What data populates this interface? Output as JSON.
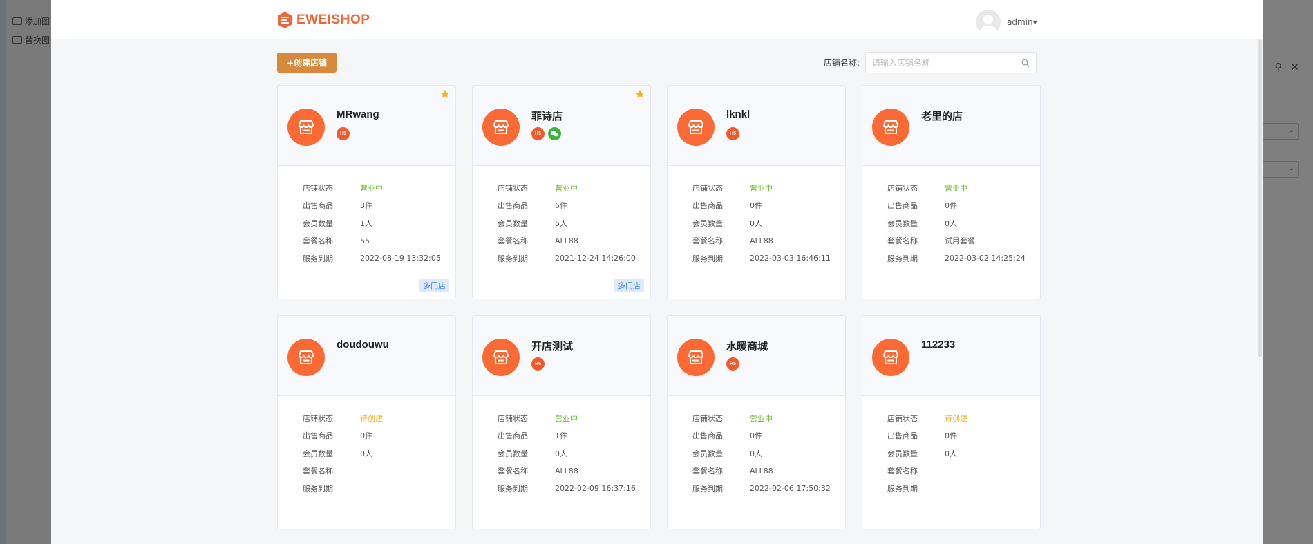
{
  "background": {
    "items": [
      "添加图",
      "替换图"
    ]
  },
  "header": {
    "logo_text": "EWEISHOP",
    "user_name": "admin▾"
  },
  "toolbar": {
    "create_label": "+创建店铺",
    "search_label": "店铺名称:",
    "search_placeholder": "请输入店铺名称"
  },
  "labels": {
    "status": "店铺状态",
    "goods": "出售商品",
    "members": "会员数量",
    "package": "套餐名称",
    "expire": "服务到期"
  },
  "shops": [
    {
      "name": "MRwang",
      "tags": [
        "H5"
      ],
      "starred": true,
      "status": "营业中",
      "status_color": "#6dba2c",
      "goods": "3件",
      "members": "1人",
      "package": "55",
      "expire": "2022-08-19 13:32:05",
      "badge": "多门店"
    },
    {
      "name": "菲诗店",
      "tags": [
        "H5",
        "wechat"
      ],
      "starred": true,
      "status": "营业中",
      "status_color": "#6dba2c",
      "goods": "6件",
      "members": "5人",
      "package": "ALL88",
      "expire": "2021-12-24 14:26:00",
      "badge": "多门店"
    },
    {
      "name": "lknkl",
      "tags": [
        "H5"
      ],
      "starred": false,
      "status": "营业中",
      "status_color": "#6dba2c",
      "goods": "0件",
      "members": "0人",
      "package": "ALL88",
      "expire": "2022-03-03 16:46:11",
      "badge": ""
    },
    {
      "name": "老里的店",
      "tags": [],
      "starred": false,
      "status": "营业中",
      "status_color": "#6dba2c",
      "goods": "0件",
      "members": "0人",
      "package": "试用套餐",
      "expire": "2022-03-02 14:25:24",
      "badge": ""
    },
    {
      "name": "doudouwu",
      "tags": [],
      "starred": false,
      "status": "待创建",
      "status_color": "#f0b429",
      "goods": "0件",
      "members": "0人",
      "package": "",
      "expire": "",
      "badge": ""
    },
    {
      "name": "开店测试",
      "tags": [
        "H5"
      ],
      "starred": false,
      "status": "营业中",
      "status_color": "#6dba2c",
      "goods": "1件",
      "members": "0人",
      "package": "ALL88",
      "expire": "2022-02-09 16:37:16",
      "badge": ""
    },
    {
      "name": "水暖商城",
      "tags": [
        "H5"
      ],
      "starred": false,
      "status": "营业中",
      "status_color": "#6dba2c",
      "goods": "0件",
      "members": "0人",
      "package": "ALL88",
      "expire": "2022-02-06 17:50:32",
      "badge": ""
    },
    {
      "name": "112233",
      "tags": [],
      "starred": false,
      "status": "待创建",
      "status_color": "#f0b429",
      "goods": "0件",
      "members": "0人",
      "package": "",
      "expire": "",
      "badge": ""
    }
  ]
}
